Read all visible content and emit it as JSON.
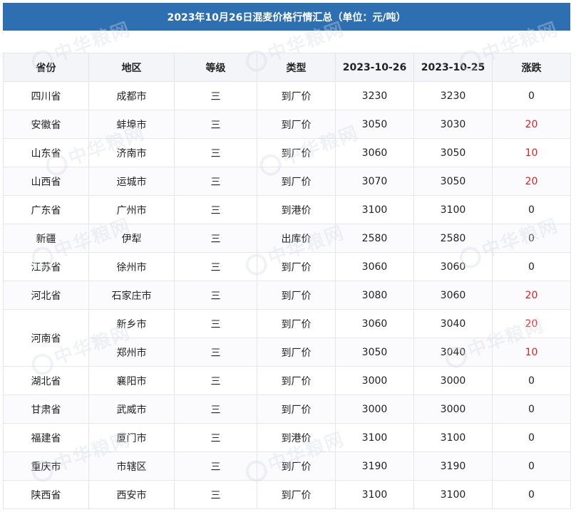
{
  "title": "2023年10月26日混麦价格行情汇总（单位：元/吨）",
  "watermark": "中华粮网",
  "columns": [
    "省份",
    "地区",
    "等级",
    "类型",
    "2023-10-26",
    "2023-10-25",
    "涨跌"
  ],
  "rows": [
    {
      "province": "四川省",
      "region": "成都市",
      "grade": "三",
      "type": "到厂价",
      "today": "3230",
      "prev": "3230",
      "change": "0"
    },
    {
      "province": "安徽省",
      "region": "蚌埠市",
      "grade": "三",
      "type": "到厂价",
      "today": "3050",
      "prev": "3030",
      "change": "20"
    },
    {
      "province": "山东省",
      "region": "济南市",
      "grade": "三",
      "type": "到厂价",
      "today": "3060",
      "prev": "3050",
      "change": "10"
    },
    {
      "province": "山西省",
      "region": "运城市",
      "grade": "三",
      "type": "到厂价",
      "today": "3070",
      "prev": "3050",
      "change": "20"
    },
    {
      "province": "广东省",
      "region": "广州市",
      "grade": "三",
      "type": "到港价",
      "today": "3100",
      "prev": "3100",
      "change": "0"
    },
    {
      "province": "新疆",
      "region": "伊犁",
      "grade": "三",
      "type": "出库价",
      "today": "2580",
      "prev": "2580",
      "change": "0"
    },
    {
      "province": "江苏省",
      "region": "徐州市",
      "grade": "三",
      "type": "到厂价",
      "today": "3060",
      "prev": "3060",
      "change": "0"
    },
    {
      "province": "河北省",
      "region": "石家庄市",
      "grade": "三",
      "type": "到厂价",
      "today": "3080",
      "prev": "3060",
      "change": "20"
    },
    {
      "province": "河南省",
      "region": "新乡市",
      "grade": "三",
      "type": "到厂价",
      "today": "3060",
      "prev": "3040",
      "change": "20"
    },
    {
      "province": "河南省",
      "region": "郑州市",
      "grade": "三",
      "type": "到厂价",
      "today": "3050",
      "prev": "3040",
      "change": "10"
    },
    {
      "province": "湖北省",
      "region": "襄阳市",
      "grade": "三",
      "type": "到厂价",
      "today": "3000",
      "prev": "3000",
      "change": "0"
    },
    {
      "province": "甘肃省",
      "region": "武威市",
      "grade": "三",
      "type": "到厂价",
      "today": "3000",
      "prev": "3000",
      "change": "0"
    },
    {
      "province": "福建省",
      "region": "厦门市",
      "grade": "三",
      "type": "到港价",
      "today": "3100",
      "prev": "3100",
      "change": "0"
    },
    {
      "province": "重庆市",
      "region": "市辖区",
      "grade": "三",
      "type": "到厂价",
      "today": "3190",
      "prev": "3190",
      "change": "0"
    },
    {
      "province": "陕西省",
      "region": "西安市",
      "grade": "三",
      "type": "到厂价",
      "today": "3100",
      "prev": "3100",
      "change": "0"
    }
  ],
  "colors": {
    "title_bg": "#2d6fb1",
    "header_bg": "#f4f5f9",
    "rise": "#e0201e"
  }
}
